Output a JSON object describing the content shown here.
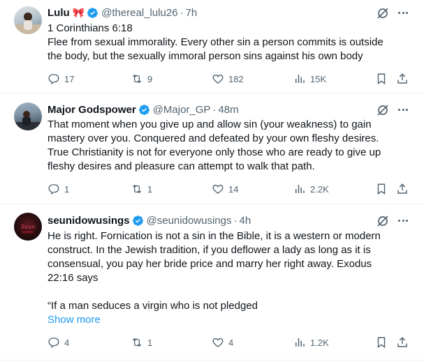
{
  "tweets": [
    {
      "name": "Lulu",
      "emoji": "🎀",
      "handle": "@thereal_lulu26",
      "time": "7h",
      "text": "1 Corinthians 6:18\nFlee from sexual immorality. Every other sin a person commits is outside the body, but the sexually immoral person sins against his own body",
      "show_more": "",
      "replies": "17",
      "retweets": "9",
      "likes": "182",
      "views": "15K",
      "avatar_colors": [
        "#b9c6cc",
        "#6d8797"
      ]
    },
    {
      "name": "Major Godspower",
      "emoji": "",
      "handle": "@Major_GP",
      "time": "48m",
      "text": "That moment when you give up and allow sin (your weakness) to gain mastery over you. Conquered and defeated by your own fleshy desires. True Christianity is not for everyone only those who are ready to give up fleshy desires and pleasure can attempt to walk that path.",
      "show_more": "",
      "replies": "1",
      "retweets": "1",
      "likes": "14",
      "views": "2.2K",
      "avatar_colors": [
        "#7f94a6",
        "#2d3b48"
      ]
    },
    {
      "name": "seunidowusings",
      "emoji": "",
      "handle": "@seunidowusings",
      "time": "4h",
      "text": "He is right. Fornication is not a sin in the Bible, it is a western or modern construct. In the Jewish tradition, if you deflower a lady as long as it is consensual, you pay her bride price and marry her right away. Exodus 22:16 says\n\n“If a man seduces a virgin who is not pledged",
      "show_more": "Show more",
      "replies": "4",
      "retweets": "1",
      "likes": "4",
      "views": "1.2K",
      "avatar_colors": [
        "#1a0a0a",
        "#b3122a"
      ]
    }
  ],
  "colors": {
    "verified": "#1d9bf0",
    "muted": "#536471",
    "link": "#1d9bf0",
    "divider": "#eff3f4"
  }
}
